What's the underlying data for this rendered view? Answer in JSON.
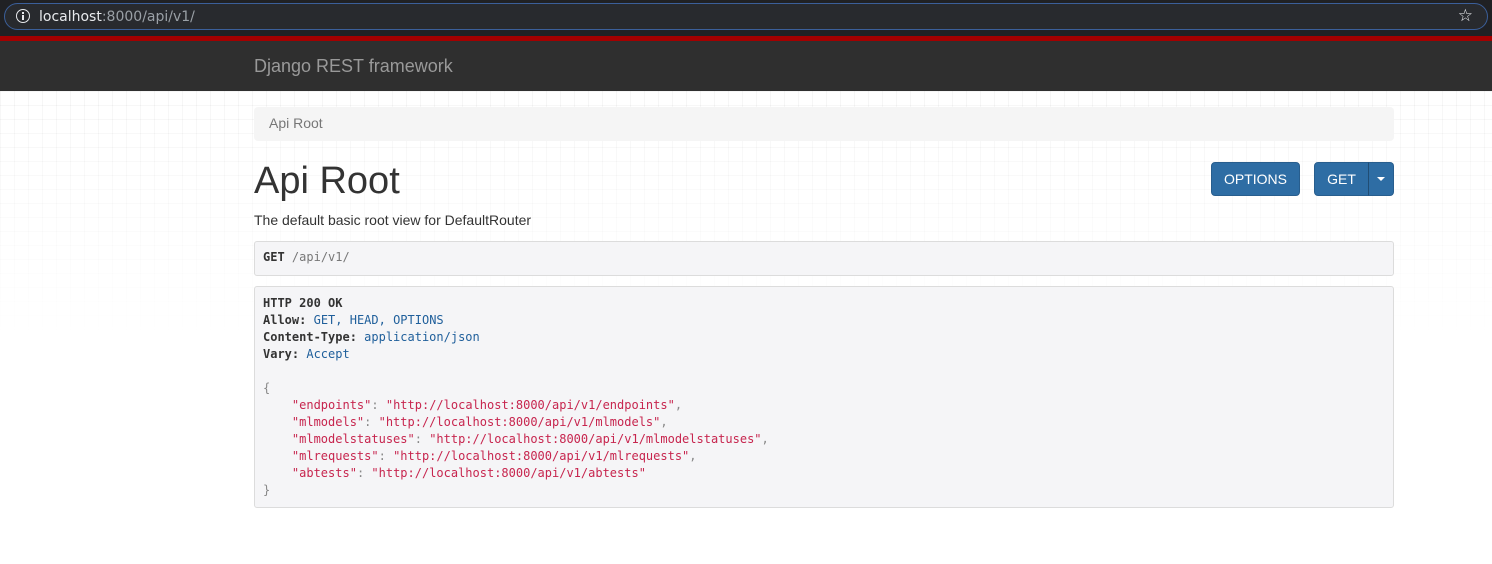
{
  "browser": {
    "url_host": "localhost",
    "url_rest": ":8000/api/v1/"
  },
  "navbar": {
    "brand": "Django REST framework"
  },
  "breadcrumb": {
    "items": [
      "Api Root"
    ]
  },
  "page": {
    "title": "Api Root",
    "description": "The default basic root view for DefaultRouter"
  },
  "buttons": {
    "options_label": "OPTIONS",
    "get_label": "GET"
  },
  "request": {
    "method": "GET",
    "path": "/api/v1/"
  },
  "response": {
    "status": "HTTP 200 OK",
    "headers": [
      {
        "key": "Allow:",
        "value": "GET, HEAD, OPTIONS"
      },
      {
        "key": "Content-Type:",
        "value": "application/json"
      },
      {
        "key": "Vary:",
        "value": "Accept"
      }
    ],
    "body": [
      {
        "key": "\"endpoints\"",
        "value": "\"http://localhost:8000/api/v1/endpoints\""
      },
      {
        "key": "\"mlmodels\"",
        "value": "\"http://localhost:8000/api/v1/mlmodels\""
      },
      {
        "key": "\"mlmodelstatuses\"",
        "value": "\"http://localhost:8000/api/v1/mlmodelstatuses\""
      },
      {
        "key": "\"mlrequests\"",
        "value": "\"http://localhost:8000/api/v1/mlrequests\""
      },
      {
        "key": "\"abtests\"",
        "value": "\"http://localhost:8000/api/v1/abtests\""
      }
    ]
  },
  "colors": {
    "navbar_bg": "#2f2f2f",
    "accent_line": "#a30000",
    "button_primary": "#2e6da4",
    "json_string": "#c7254e"
  }
}
